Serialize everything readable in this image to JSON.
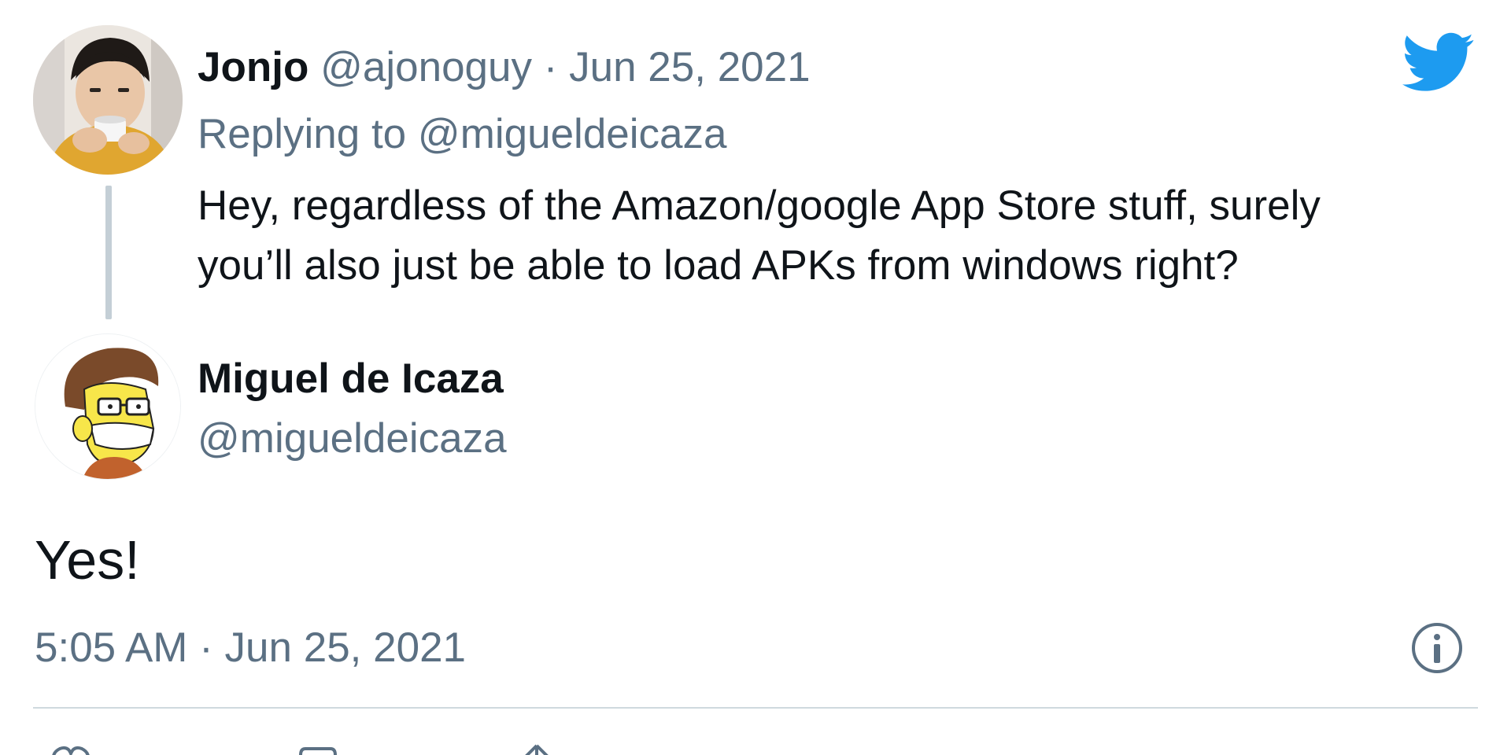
{
  "reply_tweet": {
    "author_name": "Jonjo",
    "author_handle": "@ajonoguy",
    "separator": "·",
    "date": "Jun 25, 2021",
    "replying_to_prefix": "Replying to",
    "replying_to_handle": "@migueldeicaza",
    "text_line1": "Hey, regardless of the Amazon/google App Store stuff, surely",
    "text_line2": "you’ll also just be able to load APKs from windows right?",
    "avatar_icon": "person-photo-avatar"
  },
  "main_tweet": {
    "author_name": "Miguel de Icaza",
    "author_handle": "@migueldeicaza",
    "text": "Yes!",
    "timestamp": "5:05 AM · Jun 25, 2021",
    "avatar_icon": "cartoon-avatar"
  },
  "icons": {
    "brand": "twitter-bird-icon",
    "info": "info-icon"
  },
  "colors": {
    "brand_blue": "#1d9bf0",
    "muted_text": "#5b7083",
    "thread_line": "#c4cfd6",
    "divider": "#cfd9de"
  }
}
